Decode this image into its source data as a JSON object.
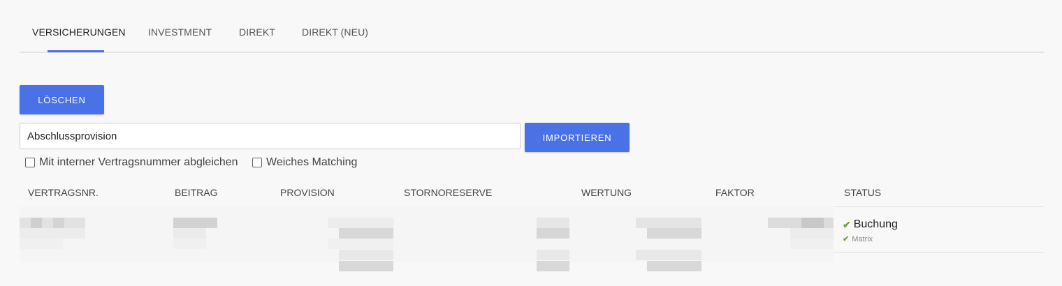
{
  "tabs": [
    {
      "label": "VERSICHERUNGEN",
      "active": true
    },
    {
      "label": "INVESTMENT",
      "active": false
    },
    {
      "label": "DIREKT",
      "active": false
    },
    {
      "label": "DIREKT (NEU)",
      "active": false
    }
  ],
  "actions": {
    "delete_label": "LÖSCHEN",
    "import_label": "IMPORTIEREN"
  },
  "import_field": {
    "value": "Abschlussprovision"
  },
  "options": {
    "match_internal_label": "Mit interner Vertragsnummer abgleichen",
    "match_internal_checked": false,
    "soft_matching_label": "Weiches Matching",
    "soft_matching_checked": false
  },
  "table": {
    "columns": [
      "VERTRAGSNR.",
      "BEITRAG",
      "PROVISION",
      "STORNORESERVE",
      "WERTUNG",
      "FAKTOR",
      "STATUS"
    ],
    "rows": [
      {
        "status": "Buchung",
        "status_sub": "Matrix"
      }
    ]
  },
  "colors": {
    "accent": "#4a72e6",
    "success": "#6aa33a",
    "background": "#f8f8f8"
  },
  "icons": {
    "status_check": "check-icon"
  }
}
